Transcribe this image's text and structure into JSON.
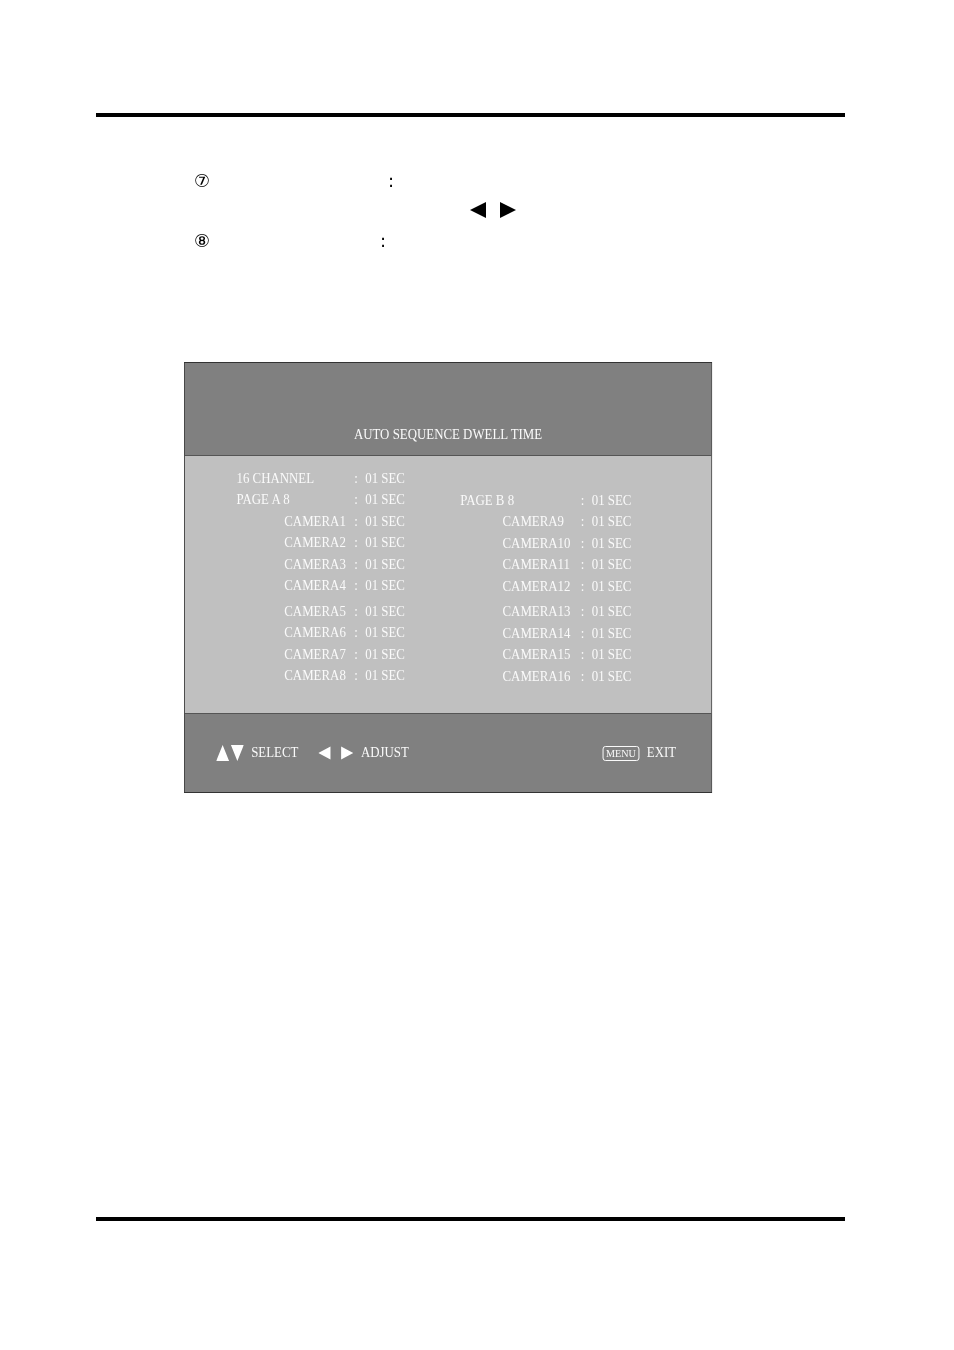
{
  "notes": [
    {
      "marker": "⑦",
      "separator": ":",
      "arrows": true
    },
    {
      "marker": "⑧",
      "separator": ":",
      "arrows": false
    }
  ],
  "osd": {
    "title": "AUTO SEQUENCE DWELL TIME",
    "columns": [
      {
        "page": {
          "label": "16 CHANNEL",
          "separator": ":",
          "value": "01 SEC"
        },
        "rows": [
          {
            "kind": "page",
            "label": "PAGE A 8",
            "separator": ":",
            "value": "01 SEC"
          },
          {
            "kind": "camera",
            "label": "CAMERA1",
            "separator": ":",
            "value": "01 SEC"
          },
          {
            "kind": "camera",
            "label": "CAMERA2",
            "separator": ":",
            "value": "01 SEC"
          },
          {
            "kind": "camera",
            "label": "CAMERA3",
            "separator": ":",
            "value": "01 SEC"
          },
          {
            "kind": "camera",
            "label": "CAMERA4",
            "separator": ":",
            "value": "01 SEC"
          },
          {
            "kind": "camera",
            "label": "CAMERA5",
            "separator": ":",
            "value": "01 SEC"
          },
          {
            "kind": "camera",
            "label": "CAMERA6",
            "separator": ":",
            "value": "01 SEC"
          },
          {
            "kind": "camera",
            "label": "CAMERA7",
            "separator": ":",
            "value": "01 SEC"
          },
          {
            "kind": "camera",
            "label": "CAMERA8",
            "separator": ":",
            "value": "01 SEC"
          }
        ]
      },
      {
        "rows": [
          {
            "kind": "page",
            "label": "PAGE B 8",
            "separator": ":",
            "value": "01 SEC"
          },
          {
            "kind": "camera",
            "label": "CAMERA9",
            "separator": ":",
            "value": "01 SEC"
          },
          {
            "kind": "camera",
            "label": "CAMERA10",
            "separator": ":",
            "value": "01 SEC"
          },
          {
            "kind": "camera",
            "label": "CAMERA11",
            "separator": ":",
            "value": "01 SEC"
          },
          {
            "kind": "camera",
            "label": "CAMERA12",
            "separator": ":",
            "value": "01 SEC"
          },
          {
            "kind": "camera",
            "label": "CAMERA13",
            "separator": ":",
            "value": "01 SEC"
          },
          {
            "kind": "camera",
            "label": "CAMERA14",
            "separator": ":",
            "value": "01 SEC"
          },
          {
            "kind": "camera",
            "label": "CAMERA15",
            "separator": ":",
            "value": "01 SEC"
          },
          {
            "kind": "camera",
            "label": "CAMERA16",
            "separator": ":",
            "value": "01 SEC"
          }
        ]
      }
    ],
    "hints": [
      {
        "kind": "updown",
        "label": "SELECT"
      },
      {
        "kind": "leftright",
        "label": "ADJUST"
      },
      {
        "kind": "key",
        "key": "MENU",
        "label": "EXIT"
      }
    ]
  }
}
